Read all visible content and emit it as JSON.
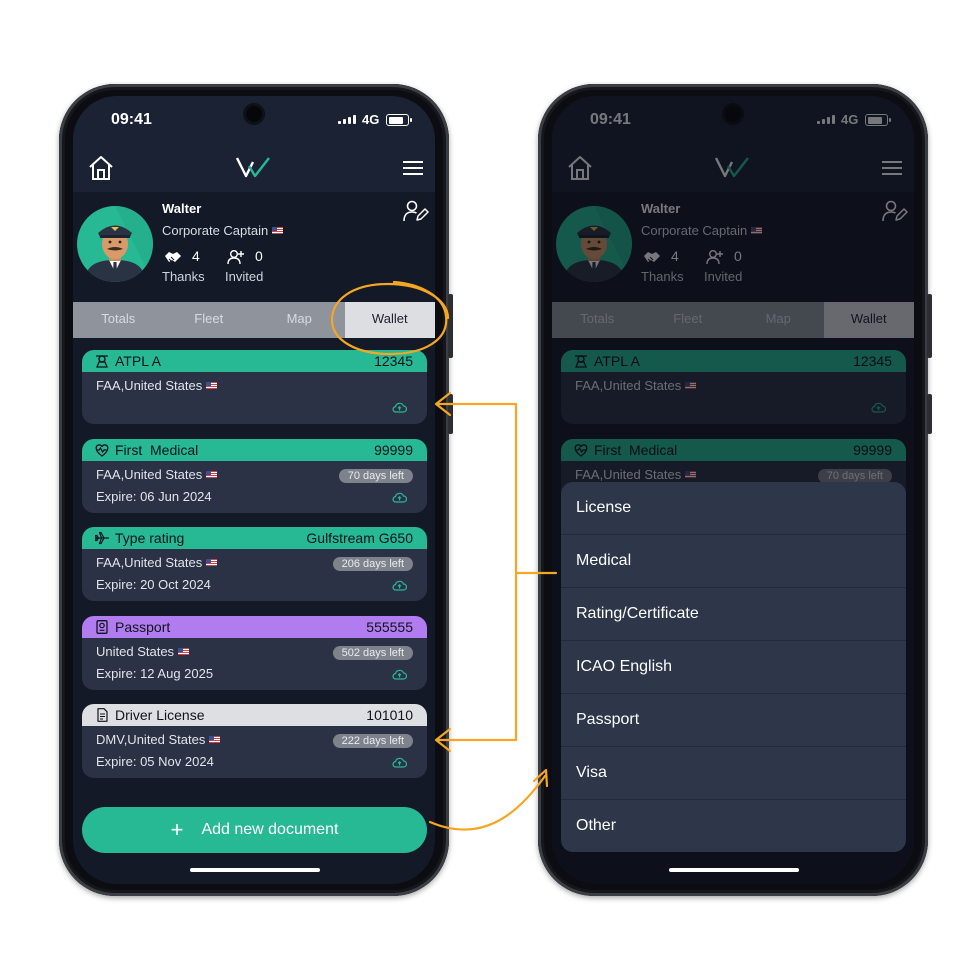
{
  "status": {
    "time": "09:41",
    "network": "4G"
  },
  "profile": {
    "name": "Walter",
    "role": "Corporate Captain",
    "thanks_count": "4",
    "thanks_label": "Thanks",
    "invited_count": "0",
    "invited_label": "Invited"
  },
  "tabs": [
    {
      "label": "Totals"
    },
    {
      "label": "Fleet"
    },
    {
      "label": "Map"
    },
    {
      "label": "Wallet"
    }
  ],
  "active_tab": "Wallet",
  "documents": [
    {
      "title": "ATPL A",
      "number": "12345",
      "issuer": "FAA,United States",
      "expire": "",
      "days_left": "",
      "color": "#27b894",
      "icon": "pilot-badge-icon"
    },
    {
      "title": "First  Medical",
      "number": "99999",
      "issuer": "FAA,United States",
      "expire": "Expire: 06 Jun 2024",
      "days_left": "70 days left",
      "color": "#27b894",
      "icon": "heartbeat-icon"
    },
    {
      "title": "Type rating",
      "number": "Gulfstream G650",
      "issuer": "FAA,United States",
      "expire": "Expire: 20 Oct 2024",
      "days_left": "206 days left",
      "color": "#27b894",
      "icon": "airplane-icon"
    },
    {
      "title": "Passport",
      "number": "555555",
      "issuer": "United States",
      "expire": "Expire: 12 Aug 2025",
      "days_left": "502 days left",
      "color": "#b07cf0",
      "icon": "passport-icon"
    },
    {
      "title": "Driver License",
      "number": "101010",
      "issuer": "DMV,United States",
      "expire": "Expire: 05 Nov 2024",
      "days_left": "222 days left",
      "color": "#dddfe2",
      "icon": "document-icon"
    }
  ],
  "add_button_label": "Add new document",
  "add_button_icon": "plus-icon",
  "document_types": [
    "License",
    "Medical",
    "Rating/Certificate",
    "ICAO English",
    "Passport",
    "Visa",
    "Other"
  ],
  "colors": {
    "accent": "#27b894",
    "annotation": "#f5a623",
    "panel": "#2b3245",
    "background": "#141927"
  }
}
